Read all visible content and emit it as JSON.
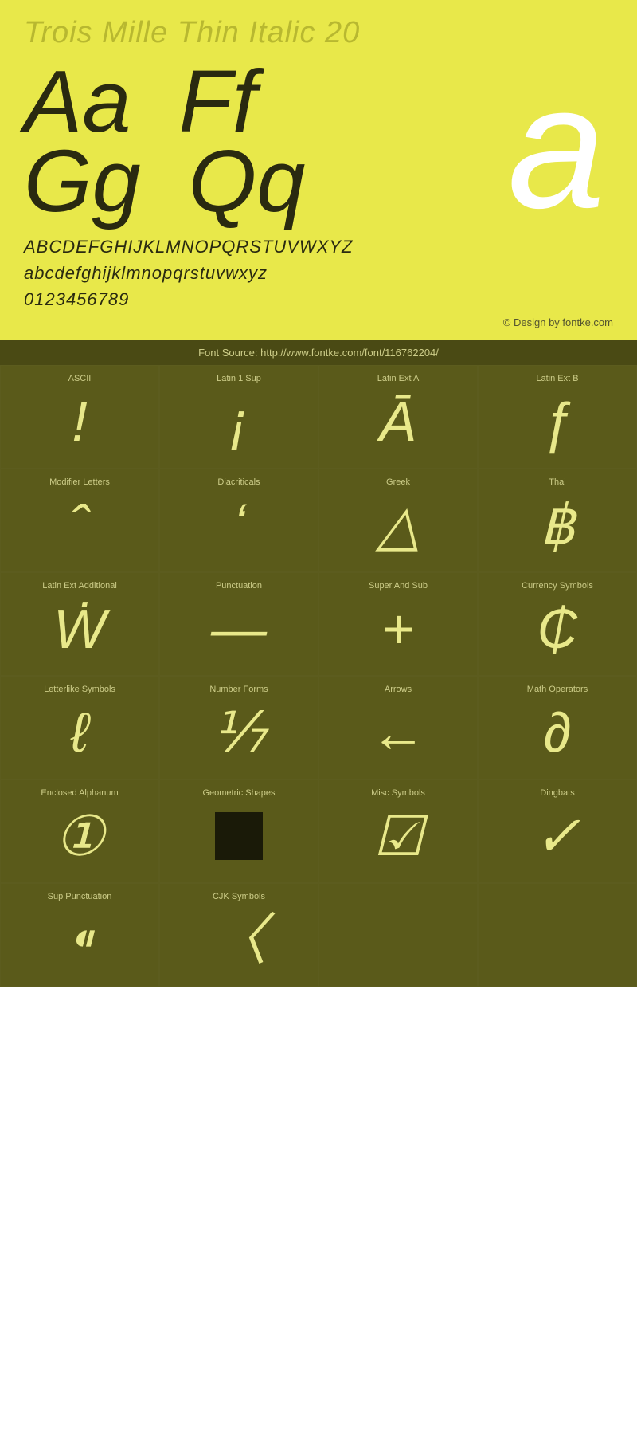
{
  "header": {
    "title": "Trois Mille Thin Italic 20",
    "glyphs_row1": [
      "Aa",
      "Ff"
    ],
    "glyphs_row2": [
      "Gg",
      "Qq"
    ],
    "hero_glyph": "a",
    "alphabet_upper": "ABCDEFGHIJKLMNOPQRSTUVWXYZ",
    "alphabet_lower": "abcdefghijklmnopqrstuvwxyz",
    "digits": "0123456789",
    "credit": "© Design by fontke.com",
    "source": "Font Source: http://www.fontke.com/font/116762204/"
  },
  "unicode_blocks": [
    {
      "label": "ASCII",
      "glyph": "!",
      "italic": true
    },
    {
      "label": "Latin 1 Sup",
      "glyph": "¡",
      "italic": true
    },
    {
      "label": "Latin Ext A",
      "glyph": "Ā",
      "italic": true
    },
    {
      "label": "Latin Ext B",
      "glyph": "ƒ",
      "italic": true
    },
    {
      "label": "Modifier Letters",
      "glyph": "ˆ",
      "italic": true
    },
    {
      "label": "Diacriticals",
      "glyph": "ʻ",
      "italic": true
    },
    {
      "label": "Greek",
      "glyph": "△",
      "italic": true
    },
    {
      "label": "Thai",
      "glyph": "฿",
      "italic": true
    },
    {
      "label": "Latin Ext Additional",
      "glyph": "Ẇ",
      "italic": true
    },
    {
      "label": "Punctuation",
      "glyph": "—",
      "italic": true
    },
    {
      "label": "Super And Sub",
      "glyph": "+",
      "italic": true
    },
    {
      "label": "Currency Symbols",
      "glyph": "₵",
      "italic": true
    },
    {
      "label": "Letterlike Symbols",
      "glyph": "ℓ",
      "italic": true
    },
    {
      "label": "Number Forms",
      "glyph": "⅐",
      "italic": true
    },
    {
      "label": "Arrows",
      "glyph": "←",
      "italic": true
    },
    {
      "label": "Math Operators",
      "glyph": "∂",
      "italic": true
    },
    {
      "label": "Enclosed Alphanum",
      "glyph": "①",
      "italic": true
    },
    {
      "label": "Geometric Shapes",
      "glyph": "■",
      "italic": false,
      "special": "filled"
    },
    {
      "label": "Misc Symbols",
      "glyph": "☑",
      "italic": true
    },
    {
      "label": "Dingbats",
      "glyph": "✓",
      "italic": true
    },
    {
      "label": "Sup Punctuation",
      "glyph": "⁌",
      "italic": true
    },
    {
      "label": "CJK Symbols",
      "glyph": "〈",
      "italic": true
    },
    {
      "label": "",
      "glyph": "",
      "italic": true
    },
    {
      "label": "",
      "glyph": "",
      "italic": true
    }
  ]
}
